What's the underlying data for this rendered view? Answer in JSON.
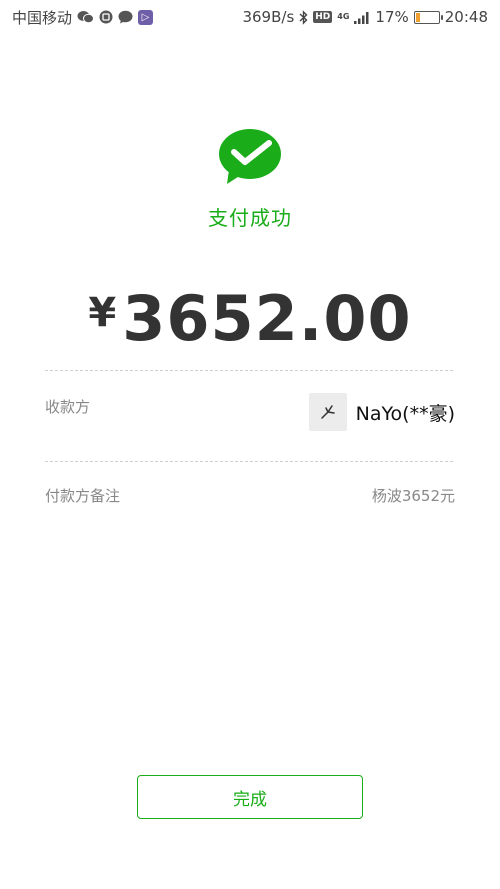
{
  "status_bar": {
    "carrier": "中国移动",
    "network_speed": "369B/s",
    "hd_label": "HD",
    "net_type": "4G",
    "battery_percent": "17%",
    "battery_level": 0.17,
    "time": "20:48",
    "app_badge": "▷"
  },
  "payment": {
    "status_title": "支付成功",
    "currency_symbol": "¥",
    "amount": "3652.00",
    "accent_color": "#1aad19"
  },
  "details": {
    "payee_label": "收款方",
    "payee_name": "NaYo(**豪)",
    "remark_label": "付款方备注",
    "remark_value": "杨波3652元"
  },
  "actions": {
    "done_label": "完成"
  }
}
